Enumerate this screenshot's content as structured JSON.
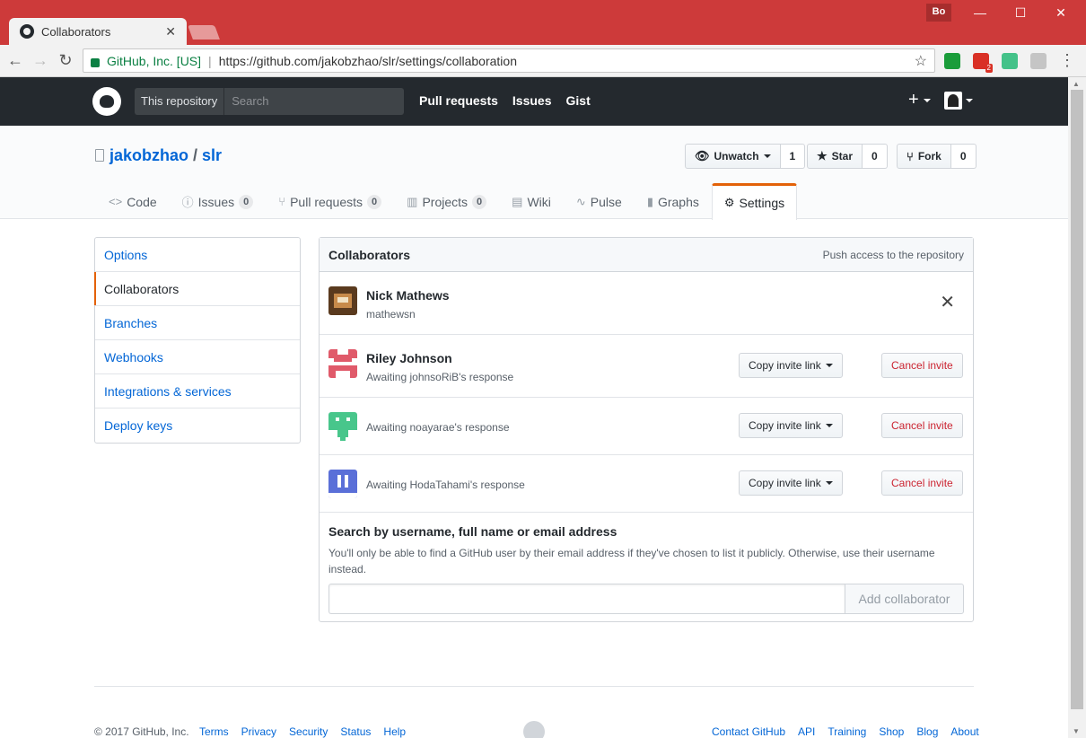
{
  "browser": {
    "tab_title": "Collaborators",
    "tab_close": "✕",
    "profile": "Bo",
    "window_controls": [
      "—",
      "☐",
      "✕"
    ],
    "secure_label": "GitHub, Inc. [US]",
    "separator": "|",
    "url": "https://github.com/jakobzhao/slr/settings/collaboration",
    "extensions": [
      {
        "name": "check-extension",
        "color": "#1a9c3a"
      },
      {
        "name": "gmail-extension",
        "color": "#d93025",
        "badge": "2"
      },
      {
        "name": "green-extension",
        "color": "#44c289"
      },
      {
        "name": "shield-extension",
        "color": "#c5c5c5"
      }
    ]
  },
  "gh_header": {
    "scope_label": "This repository",
    "search_placeholder": "Search",
    "nav": [
      "Pull requests",
      "Issues",
      "Gist"
    ],
    "plus": "+"
  },
  "repo": {
    "owner": "jakobzhao",
    "slash": "/",
    "name": "slr",
    "watch_label": "Unwatch",
    "watch_count": "1",
    "star_label": "Star",
    "star_count": "0",
    "fork_label": "Fork",
    "fork_count": "0"
  },
  "reponav": [
    {
      "label": "Code",
      "icon": "<>",
      "count": null,
      "selected": false
    },
    {
      "label": "Issues",
      "icon": "ⓘ",
      "count": "0",
      "selected": false
    },
    {
      "label": "Pull requests",
      "icon": "⑂",
      "count": "0",
      "selected": false
    },
    {
      "label": "Projects",
      "icon": "▥",
      "count": "0",
      "selected": false
    },
    {
      "label": "Wiki",
      "icon": "▤",
      "count": null,
      "selected": false
    },
    {
      "label": "Pulse",
      "icon": "∿",
      "count": null,
      "selected": false
    },
    {
      "label": "Graphs",
      "icon": "▮",
      "count": null,
      "selected": false
    },
    {
      "label": "Settings",
      "icon": "⚙",
      "count": null,
      "selected": true
    }
  ],
  "sidebar": {
    "items": [
      "Options",
      "Collaborators",
      "Branches",
      "Webhooks",
      "Integrations & services",
      "Deploy keys"
    ],
    "selected_index": 1
  },
  "collaborators": {
    "title": "Collaborators",
    "note": "Push access to the repository",
    "members": [
      {
        "name": "Nick Mathews",
        "login": "mathewsn",
        "remove": "✕"
      }
    ],
    "invites": [
      {
        "name": "Riley Johnson",
        "status": "Awaiting johnsoRiB's response",
        "avatar_color": "#e05a6a"
      },
      {
        "name": "",
        "status": "Awaiting noayarae's response",
        "avatar_color": "#48c68b"
      },
      {
        "name": "",
        "status": "Awaiting HodaTahami's response",
        "avatar_color": "#5a6fd8"
      }
    ],
    "copy_label": "Copy invite link",
    "cancel_label": "Cancel invite",
    "search_heading": "Search by username, full name or email address",
    "search_note": "You'll only be able to find a GitHub user by their email address if they've chosen to list it publicly. Otherwise, use their username instead.",
    "add_button": "Add collaborator"
  },
  "footer": {
    "copyright": "© 2017 GitHub, Inc.",
    "left_links": [
      "Terms",
      "Privacy",
      "Security",
      "Status",
      "Help"
    ],
    "right_links": [
      "Contact GitHub",
      "API",
      "Training",
      "Shop",
      "Blog",
      "About"
    ]
  }
}
